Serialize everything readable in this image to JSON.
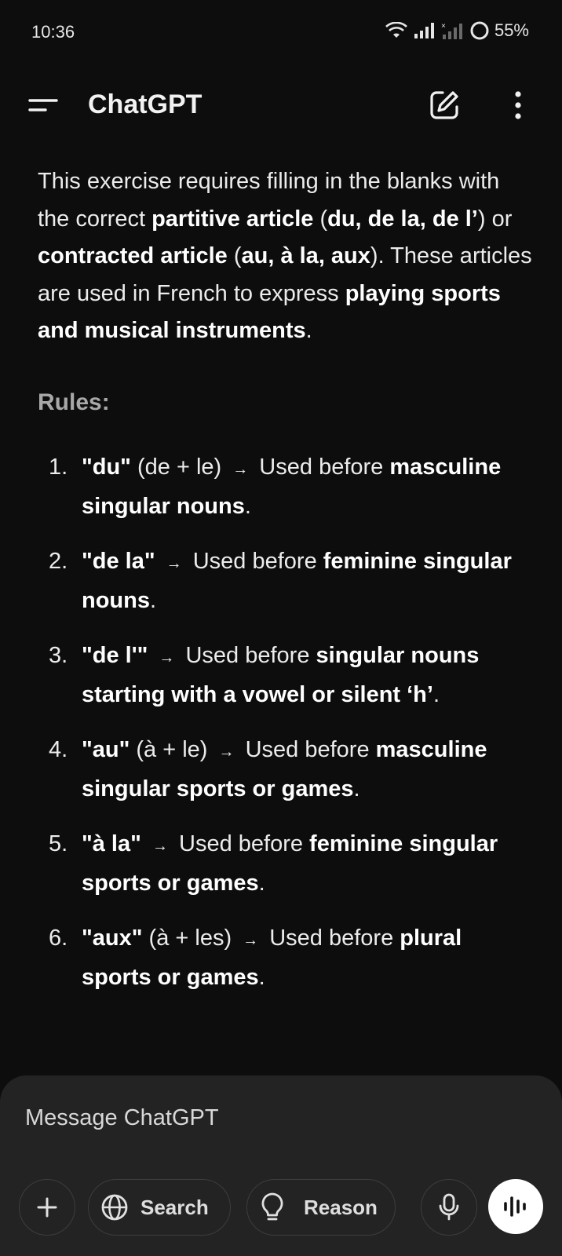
{
  "status_bar": {
    "time": "10:36",
    "battery": "55%"
  },
  "header": {
    "title": "ChatGPT"
  },
  "message": {
    "intro": [
      {
        "text": "This exercise requires filling in the blanks with the correct ",
        "bold": false
      },
      {
        "text": "partitive article",
        "bold": true
      },
      {
        "text": " (",
        "bold": false
      },
      {
        "text": "du, de la, de l’",
        "bold": true
      },
      {
        "text": ") or ",
        "bold": false
      },
      {
        "text": "contracted article",
        "bold": true
      },
      {
        "text": " (",
        "bold": false
      },
      {
        "text": "au, à la, aux",
        "bold": true
      },
      {
        "text": "). These articles are used in French to express ",
        "bold": false
      },
      {
        "text": "playing sports and musical instruments",
        "bold": true
      },
      {
        "text": ".",
        "bold": false
      }
    ],
    "rules_heading": "Rules:",
    "rules": [
      {
        "number": "1.",
        "term": "\"du\"",
        "note": " (de + le) ",
        "arrow": "→",
        "text": " Used before ",
        "bold_text": "masculine singular nouns",
        "end": "."
      },
      {
        "number": "2.",
        "term": "\"de la\"",
        "note": " ",
        "arrow": "→",
        "text": " Used before ",
        "bold_text": "feminine singular nouns",
        "end": "."
      },
      {
        "number": "3.",
        "term": "\"de l'\"",
        "note": " ",
        "arrow": "→",
        "text": " Used before ",
        "bold_text": "singular nouns starting with a vowel or silent ‘h’",
        "end": "."
      },
      {
        "number": "4.",
        "term": "\"au\"",
        "note": " (à + le) ",
        "arrow": "→",
        "text": " Used before ",
        "bold_text": "masculine singular sports or games",
        "end": "."
      },
      {
        "number": "5.",
        "term": "\"à la\"",
        "note": " ",
        "arrow": "→",
        "text": " Used before ",
        "bold_text": "feminine singular sports or games",
        "end": "."
      },
      {
        "number": "6.",
        "term": "\"aux\"",
        "note": " (à + les) ",
        "arrow": "→",
        "text": " Used before ",
        "bold_text": "plural sports or games",
        "end": "."
      }
    ]
  },
  "composer": {
    "placeholder": "Message ChatGPT",
    "search_label": "Search",
    "reason_label": "Reason"
  },
  "icons": {
    "menu": "menu-icon",
    "edit": "new-chat-icon",
    "more": "more-vertical-icon",
    "plus": "plus-icon",
    "globe": "globe-icon",
    "bulb": "lightbulb-icon",
    "mic": "microphone-icon",
    "voice": "voice-waveform-icon"
  }
}
